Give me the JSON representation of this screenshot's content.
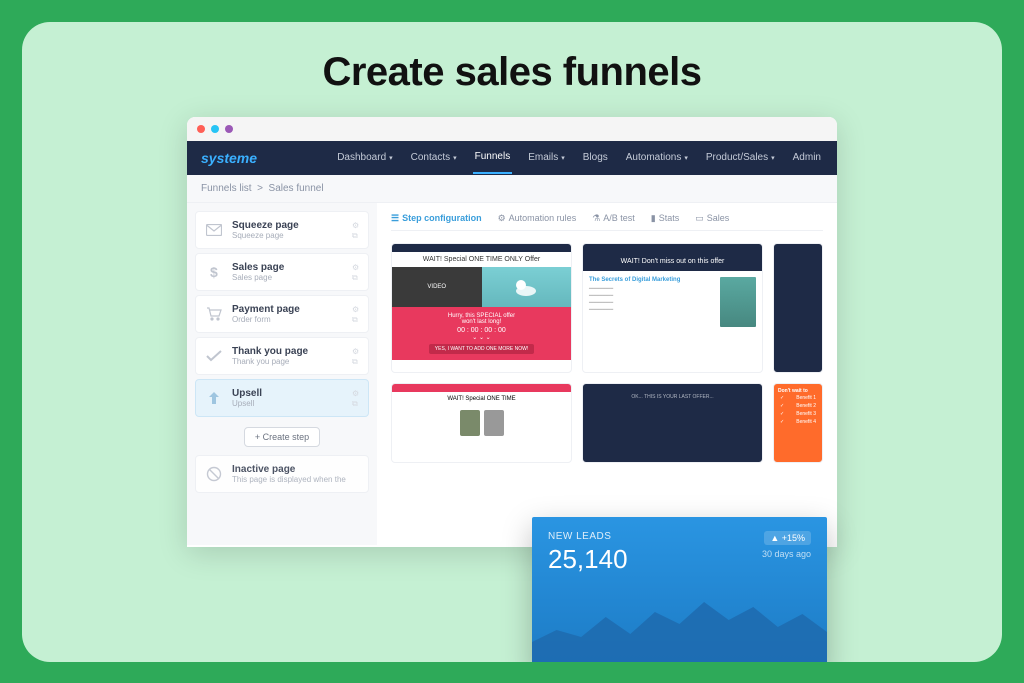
{
  "hero": {
    "title": "Create sales funnels"
  },
  "logo": "systeme",
  "nav": [
    {
      "label": "Dashboard",
      "dropdown": true,
      "active": false
    },
    {
      "label": "Contacts",
      "dropdown": true,
      "active": false
    },
    {
      "label": "Funnels",
      "dropdown": false,
      "active": true
    },
    {
      "label": "Emails",
      "dropdown": true,
      "active": false
    },
    {
      "label": "Blogs",
      "dropdown": false,
      "active": false
    },
    {
      "label": "Automations",
      "dropdown": true,
      "active": false
    },
    {
      "label": "Product/Sales",
      "dropdown": true,
      "active": false
    },
    {
      "label": "Admin",
      "dropdown": false,
      "active": false
    }
  ],
  "breadcrumb": {
    "root": "Funnels list",
    "current": "Sales funnel"
  },
  "steps": [
    {
      "title": "Squeeze page",
      "sub": "Squeeze page",
      "icon": "envelope"
    },
    {
      "title": "Sales page",
      "sub": "Sales page",
      "icon": "dollar"
    },
    {
      "title": "Payment page",
      "sub": "Order form",
      "icon": "cart"
    },
    {
      "title": "Thank you page",
      "sub": "Thank you page",
      "icon": "check"
    },
    {
      "title": "Upsell",
      "sub": "Upsell",
      "icon": "arrow-up",
      "selected": true
    }
  ],
  "create_step": "+ Create step",
  "inactive": {
    "title": "Inactive page",
    "sub": "This page is displayed when the"
  },
  "tabs": [
    {
      "label": "Step configuration",
      "icon": "list",
      "active": true
    },
    {
      "label": "Automation rules",
      "icon": "gear",
      "active": false
    },
    {
      "label": "A/B test",
      "icon": "flask",
      "active": false
    },
    {
      "label": "Stats",
      "icon": "bar",
      "active": false
    },
    {
      "label": "Sales",
      "icon": "tag",
      "active": false
    }
  ],
  "templates": {
    "t1": {
      "banner": "WAIT! Special ONE TIME ONLY Offer",
      "video": "VIDEO",
      "cta_top": "Hurry, this SPECIAL offer",
      "cta_bot": "won't last long!",
      "timer": "00 : 00 : 00 : 00",
      "btn": "YES, I WANT TO ADD ONE MORE NOW!"
    },
    "t2": {
      "hero": "WAIT! Don't miss out on this offer",
      "headline": "The Secrets of Digital Marketing",
      "book": "The Secrets of Digital Marketing"
    },
    "t4": {
      "banner": "WAIT! Special ONE TIME"
    },
    "t5": {
      "text": "OK... THIS IS YOUR LAST OFFER..."
    },
    "t6": {
      "head": "Don't wait to",
      "rows": [
        "Benefit 1",
        "Benefit 2",
        "Benefit 3",
        "Benefit 4"
      ]
    }
  },
  "stats": {
    "label": "NEW LEADS",
    "value": "25,140",
    "pct": "▲ +15%",
    "sub": "30 days ago"
  },
  "chart_data": {
    "type": "area",
    "title": "New Leads",
    "x": [
      0,
      1,
      2,
      3,
      4,
      5,
      6,
      7,
      8,
      9,
      10,
      11,
      12
    ],
    "values": [
      30,
      42,
      35,
      55,
      38,
      60,
      48,
      70,
      52,
      65,
      45,
      58,
      40
    ],
    "ylim": [
      0,
      80
    ],
    "color": "#1e6bb0"
  }
}
